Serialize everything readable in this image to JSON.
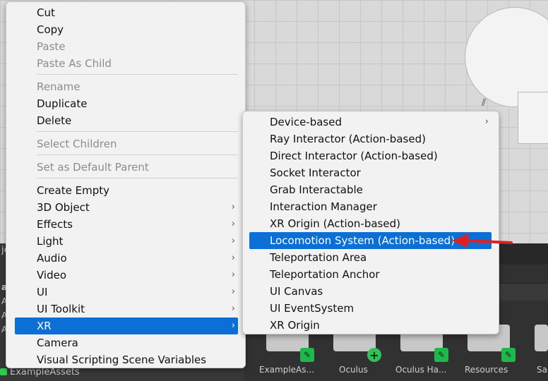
{
  "scene": {
    "background_color": "#d9d9d9"
  },
  "left_panel": {
    "title_fragment": "je",
    "rows": [
      "a",
      "A",
      "A",
      "A"
    ],
    "bottom_asset_label": "ExampleAssets"
  },
  "project_assets": {
    "folders": [
      {
        "label": "ExampleAs...",
        "badge": "edit-icon"
      },
      {
        "label": "Oculus",
        "badge": "plus-icon"
      },
      {
        "label": "Oculus Ha...",
        "badge": "edit-icon"
      },
      {
        "label": "Resources",
        "badge": "edit-icon"
      },
      {
        "label": "Sa",
        "badge": "none"
      }
    ]
  },
  "context_menu": {
    "items": [
      {
        "label": "Cut",
        "disabled": false
      },
      {
        "label": "Copy",
        "disabled": false
      },
      {
        "label": "Paste",
        "disabled": true
      },
      {
        "label": "Paste As Child",
        "disabled": true
      },
      {
        "label": "Rename",
        "disabled": true
      },
      {
        "label": "Duplicate",
        "disabled": false
      },
      {
        "label": "Delete",
        "disabled": false
      },
      {
        "label": "Select Children",
        "disabled": true
      },
      {
        "label": "Set as Default Parent",
        "disabled": true
      },
      {
        "label": "Create Empty",
        "disabled": false
      },
      {
        "label": "3D Object",
        "disabled": false,
        "submenu": true
      },
      {
        "label": "Effects",
        "disabled": false,
        "submenu": true
      },
      {
        "label": "Light",
        "disabled": false,
        "submenu": true
      },
      {
        "label": "Audio",
        "disabled": false,
        "submenu": true
      },
      {
        "label": "Video",
        "disabled": false,
        "submenu": true
      },
      {
        "label": "UI",
        "disabled": false,
        "submenu": true
      },
      {
        "label": "UI Toolkit",
        "disabled": false,
        "submenu": true
      },
      {
        "label": "XR",
        "disabled": false,
        "submenu": true,
        "selected": true
      },
      {
        "label": "Camera",
        "disabled": false
      },
      {
        "label": "Visual Scripting Scene Variables",
        "disabled": false
      }
    ],
    "arrow_glyph": "›"
  },
  "xr_submenu": {
    "items": [
      {
        "label": "Device-based",
        "submenu": true
      },
      {
        "label": "Ray Interactor (Action-based)"
      },
      {
        "label": "Direct Interactor (Action-based)"
      },
      {
        "label": "Socket Interactor"
      },
      {
        "label": "Grab Interactable"
      },
      {
        "label": "Interaction Manager"
      },
      {
        "label": "XR Origin (Action-based)"
      },
      {
        "label": "Locomotion System (Action-based)",
        "selected": true
      },
      {
        "label": "Teleportation Area"
      },
      {
        "label": "Teleportation Anchor"
      },
      {
        "label": "UI Canvas"
      },
      {
        "label": "UI EventSystem"
      },
      {
        "label": "XR Origin"
      }
    ]
  },
  "colors": {
    "menu_bg": "#f2f2f2",
    "selection": "#0b6fd6",
    "disabled_text": "#8c8c8c",
    "annotation_arrow": "#e02020"
  }
}
